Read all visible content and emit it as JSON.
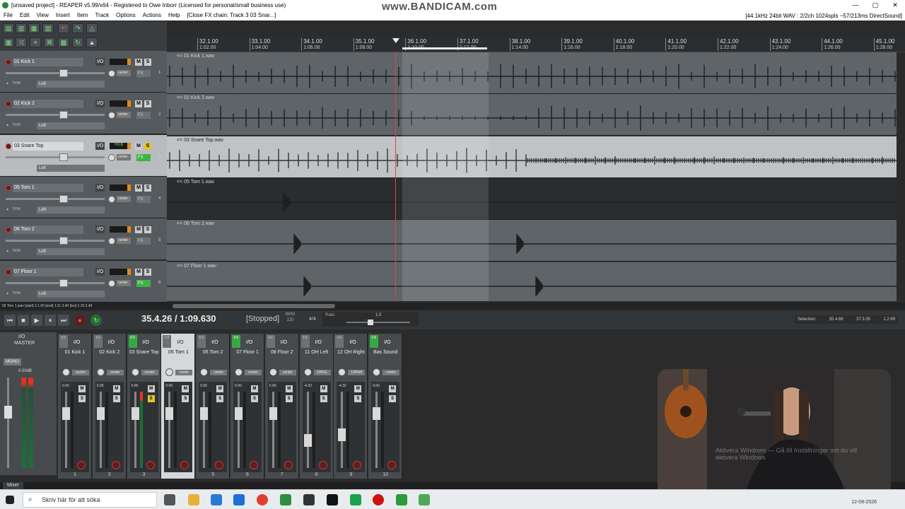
{
  "window": {
    "title": "[unsaved project] - REAPER v5.99/x64 - Registered to Owe Inborr (Licensed for personal/small business use)",
    "watermark": "www.BANDICAM.com",
    "audio_info": "[44.1kHz 24bit WAV : 2/2ch 1024spls ~57/213ms DirectSound]",
    "controls": [
      "—",
      "▢",
      "✕"
    ]
  },
  "menu": [
    "File",
    "Edit",
    "View",
    "Insert",
    "Item",
    "Track",
    "Options",
    "Actions",
    "Help",
    "[Close FX chain: Track 3 03 Snar...]"
  ],
  "ruler": [
    {
      "bar": "32.1.00",
      "time": "1:02.00"
    },
    {
      "bar": "33.1.00",
      "time": "1:04.00"
    },
    {
      "bar": "34.1.00",
      "time": "1:06.00"
    },
    {
      "bar": "35.1.00",
      "time": "1:08.00"
    },
    {
      "bar": "36.1.00",
      "time": "1:10.00"
    },
    {
      "bar": "37.1.00",
      "time": "1:12.00"
    },
    {
      "bar": "38.1.00",
      "time": "1:14.00"
    },
    {
      "bar": "39.1.00",
      "time": "1:16.00"
    },
    {
      "bar": "40.1.00",
      "time": "1:18.00"
    },
    {
      "bar": "41.1.00",
      "time": "1:20.00"
    },
    {
      "bar": "42.1.00",
      "time": "1:22.00"
    },
    {
      "bar": "43.1.00",
      "time": "1:24.00"
    },
    {
      "bar": "44.1.00",
      "time": "1:26.00"
    },
    {
      "bar": "45.1.00",
      "time": "1:28.00"
    }
  ],
  "tracks": [
    {
      "name": "01 Kick 1",
      "volume": "",
      "fx_on": false,
      "selected": false,
      "item": "<< 01 Kick 1.wav",
      "num": "1",
      "pan": "center",
      "pan_mode": "Left",
      "trim": "TRIM",
      "io": "I/O"
    },
    {
      "name": "02 Kick 2",
      "volume": "",
      "fx_on": false,
      "selected": false,
      "item": "<< 02 Kick 2.wav",
      "num": "2",
      "pan": "center",
      "pan_mode": "Left",
      "trim": "TRIM",
      "io": "I/O"
    },
    {
      "name": "03 Snare Top",
      "volume": "+0.8",
      "fx_on": true,
      "selected": true,
      "item": "<< 03 Snare Top.wav",
      "num": "3",
      "pan": "center",
      "pan_mode": "Left",
      "trim": "TRIM",
      "io": "I/O"
    },
    {
      "name": "05 Tom 1",
      "volume": "",
      "fx_on": false,
      "selected": false,
      "item": "<< 05 Tom 1.wav",
      "num": "4",
      "pan": "center",
      "pan_mode": "Left",
      "trim": "TRIM",
      "io": "I/O"
    },
    {
      "name": "06 Tom 2",
      "volume": "",
      "fx_on": false,
      "selected": false,
      "item": "<< 06 Tom 2.wav",
      "num": "5",
      "pan": "center",
      "pan_mode": "Left",
      "trim": "TRIM",
      "io": "I/O"
    },
    {
      "name": "07 Floor 1",
      "volume": "",
      "fx_on": true,
      "selected": false,
      "item": "<< 07 Floor 1.wav",
      "num": "6",
      "pan": "center",
      "pan_mode": "Left",
      "trim": "TRIM",
      "io": "I/O"
    }
  ],
  "status_line": "05 Tom 1.wav [start] 1:1.00 [end] 1:11 3.40 [len] 1:10.2.40",
  "transport": {
    "time": "35.4.26 / 1:09.630",
    "state": "[Stopped]",
    "bpm_label": "BPM",
    "bpm": "120",
    "sig": "4/4",
    "rate_label": "Rate:",
    "rate": "1.0",
    "selection": {
      "label": "Selection:",
      "start": "35.4.66",
      "end": "37.3.35",
      "length": "1.2.69"
    }
  },
  "master": {
    "label": "MASTER",
    "io": "I/O",
    "mono": "MONO",
    "volume": "0.00dB",
    "pan": "center"
  },
  "strips": [
    {
      "name": "01 Kick 1",
      "vol": "0.00",
      "pan": "center",
      "num": "1",
      "fx": false,
      "solo": false,
      "sel": false,
      "active": false
    },
    {
      "name": "02 Kick 2",
      "vol": "0.00",
      "pan": "center",
      "num": "2",
      "fx": false,
      "solo": false,
      "sel": false,
      "active": false
    },
    {
      "name": "03 Snare Top",
      "vol": "0.00",
      "pan": "center",
      "num": "3",
      "fx": true,
      "solo": true,
      "sel": false,
      "active": true
    },
    {
      "name": "05 Tom 1",
      "vol": "0.00",
      "pan": "center",
      "num": "4",
      "fx": false,
      "solo": false,
      "sel": true,
      "active": false
    },
    {
      "name": "06 Tom 2",
      "vol": "0.00",
      "pan": "center",
      "num": "5",
      "fx": false,
      "solo": false,
      "sel": false,
      "active": false
    },
    {
      "name": "07 Floor 1",
      "vol": "0.00",
      "pan": "center",
      "num": "6",
      "fx": true,
      "solo": false,
      "sel": false,
      "active": false
    },
    {
      "name": "08 Floor 2",
      "vol": "0.00",
      "pan": "center",
      "num": "7",
      "fx": false,
      "solo": false,
      "sel": false,
      "active": false
    },
    {
      "name": "11 OH Left",
      "vol": "-4.32",
      "pan": "100%L",
      "num": "8",
      "fx": false,
      "solo": false,
      "sel": false,
      "active": false
    },
    {
      "name": "12 OH Right",
      "vol": "-4.32",
      "pan": "100%R",
      "num": "9",
      "fx": false,
      "solo": false,
      "sel": false,
      "active": false
    },
    {
      "name": "Bas Sound",
      "vol": "0.00",
      "pan": "center",
      "num": "10",
      "fx": true,
      "solo": false,
      "sel": false,
      "active": false
    }
  ],
  "labels": {
    "mute": "M",
    "solo": "S",
    "fx": "FX",
    "mixer_tab": "Mixer"
  },
  "taskbar": {
    "search_placeholder": "Skriv här för att söka",
    "date": "12-08-2026"
  },
  "webcam_overlay": "Aktivera Windows — Gå till Inställningar om du vill aktivera Windows"
}
